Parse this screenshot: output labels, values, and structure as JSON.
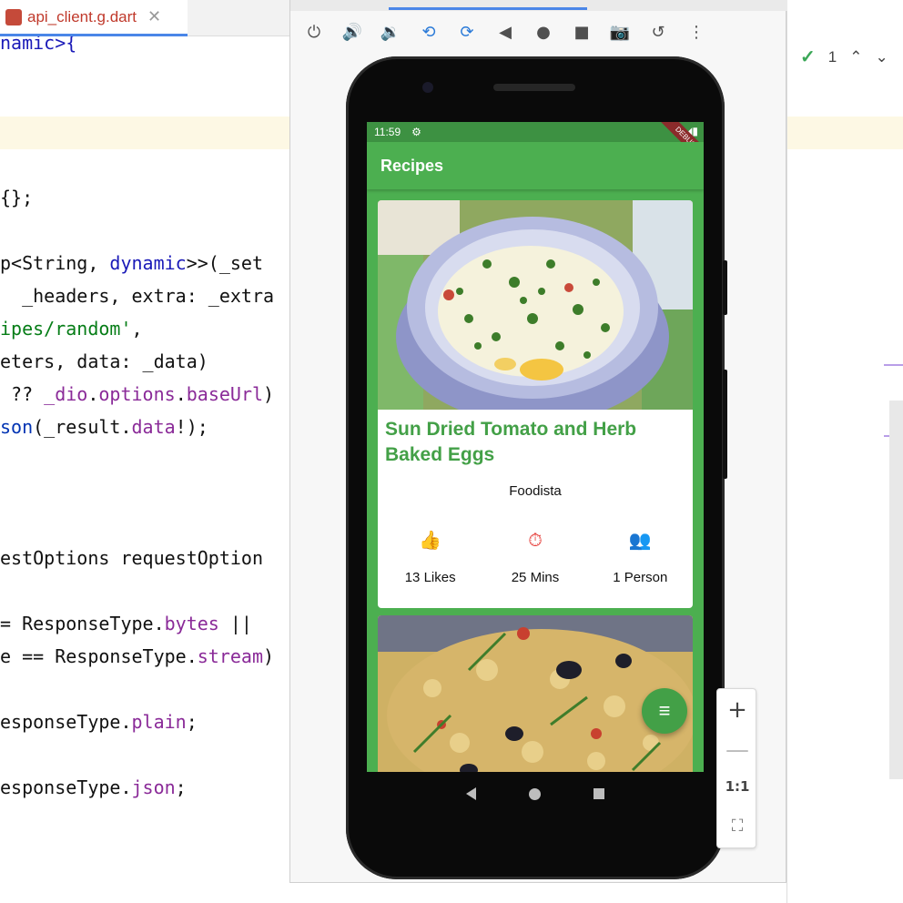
{
  "editor": {
    "tab_label": "api_client.g.dart",
    "tab_close": "✕",
    "lines": [
      {
        "segs": [
          {
            "t": "namic>{",
            "c": "ck"
          }
        ]
      },
      {
        "segs": [
          {
            "t": "{};",
            "c": ""
          }
        ]
      },
      {
        "segs": [
          {
            "t": "p<String, ",
            "c": ""
          },
          {
            "t": "dynamic",
            "c": "ck"
          },
          {
            "t": ">>(_set",
            "c": ""
          }
        ]
      },
      {
        "segs": [
          {
            "t": "  _headers, extra: _extra",
            "c": ""
          }
        ]
      },
      {
        "segs": [
          {
            "t": "ipes/random'",
            "c": "cs"
          },
          {
            "t": ",",
            "c": ""
          }
        ]
      },
      {
        "segs": [
          {
            "t": "eters, data: _data)",
            "c": ""
          }
        ]
      },
      {
        "segs": [
          {
            "t": " ?? ",
            "c": ""
          },
          {
            "t": "_dio",
            "c": "cp"
          },
          {
            "t": ".",
            "c": ""
          },
          {
            "t": "options",
            "c": "cp"
          },
          {
            "t": ".",
            "c": ""
          },
          {
            "t": "baseUrl",
            "c": "cp"
          },
          {
            "t": ")",
            "c": ""
          }
        ]
      },
      {
        "segs": [
          {
            "t": "son",
            "c": "cm"
          },
          {
            "t": "(_result.",
            "c": ""
          },
          {
            "t": "data",
            "c": "cp"
          },
          {
            "t": "!);",
            "c": ""
          }
        ]
      },
      {
        "segs": [
          {
            "t": "estOptions requestOption",
            "c": ""
          }
        ]
      },
      {
        "segs": [
          {
            "t": "= ResponseType.",
            "c": ""
          },
          {
            "t": "bytes",
            "c": "cp"
          },
          {
            "t": " ||",
            "c": ""
          }
        ]
      },
      {
        "segs": [
          {
            "t": "e == ResponseType.",
            "c": ""
          },
          {
            "t": "stream",
            "c": "cp"
          },
          {
            "t": ")",
            "c": ""
          }
        ]
      },
      {
        "segs": [
          {
            "t": "esponseType.",
            "c": ""
          },
          {
            "t": "plain",
            "c": "cp"
          },
          {
            "t": ";",
            "c": ""
          }
        ]
      },
      {
        "segs": [
          {
            "t": "esponseType.",
            "c": ""
          },
          {
            "t": "json",
            "c": "cp"
          },
          {
            "t": ";",
            "c": ""
          }
        ]
      }
    ]
  },
  "right_panel": {
    "check_count": "1",
    "check_icon": "✓",
    "up_icon": "⌃",
    "down_icon": "⌄"
  },
  "emulator_toolbar": {
    "icons": [
      {
        "name": "power-icon",
        "glyph": "⏻"
      },
      {
        "name": "volume-up-icon",
        "glyph": "🔊"
      },
      {
        "name": "volume-down-icon",
        "glyph": "🔉"
      },
      {
        "name": "rotate-left-icon",
        "glyph": "⟲"
      },
      {
        "name": "rotate-right-icon",
        "glyph": "⟳"
      },
      {
        "name": "back-icon",
        "glyph": "◀"
      },
      {
        "name": "home-icon",
        "glyph": "●"
      },
      {
        "name": "overview-icon",
        "glyph": "■"
      },
      {
        "name": "camera-icon",
        "glyph": "📷"
      },
      {
        "name": "snapshot-icon",
        "glyph": "↺"
      },
      {
        "name": "more-icon",
        "glyph": "⋮"
      }
    ]
  },
  "phone": {
    "status_time": "11:59",
    "status_gear": "⚙",
    "status_right": "▼◢▮",
    "debug_banner": "DEBUG",
    "app_title": "Recipes",
    "recipe": {
      "title": "Sun Dried Tomato and Herb Baked Eggs",
      "source": "Foodista",
      "stats": [
        {
          "icon": "thumb-up-icon",
          "glyph": "👍",
          "color": "#2a7ad8",
          "label": "13 Likes"
        },
        {
          "icon": "timer-icon",
          "glyph": "⏱",
          "color": "#e53935",
          "label": "25 Mins"
        },
        {
          "icon": "people-icon",
          "glyph": "👥",
          "color": "#43a047",
          "label": "1 Person"
        }
      ]
    },
    "fab_glyph": "≡"
  },
  "zoom": {
    "plus": "+",
    "minus": "—",
    "one_to_one": "1:1",
    "fit": "⛶"
  }
}
